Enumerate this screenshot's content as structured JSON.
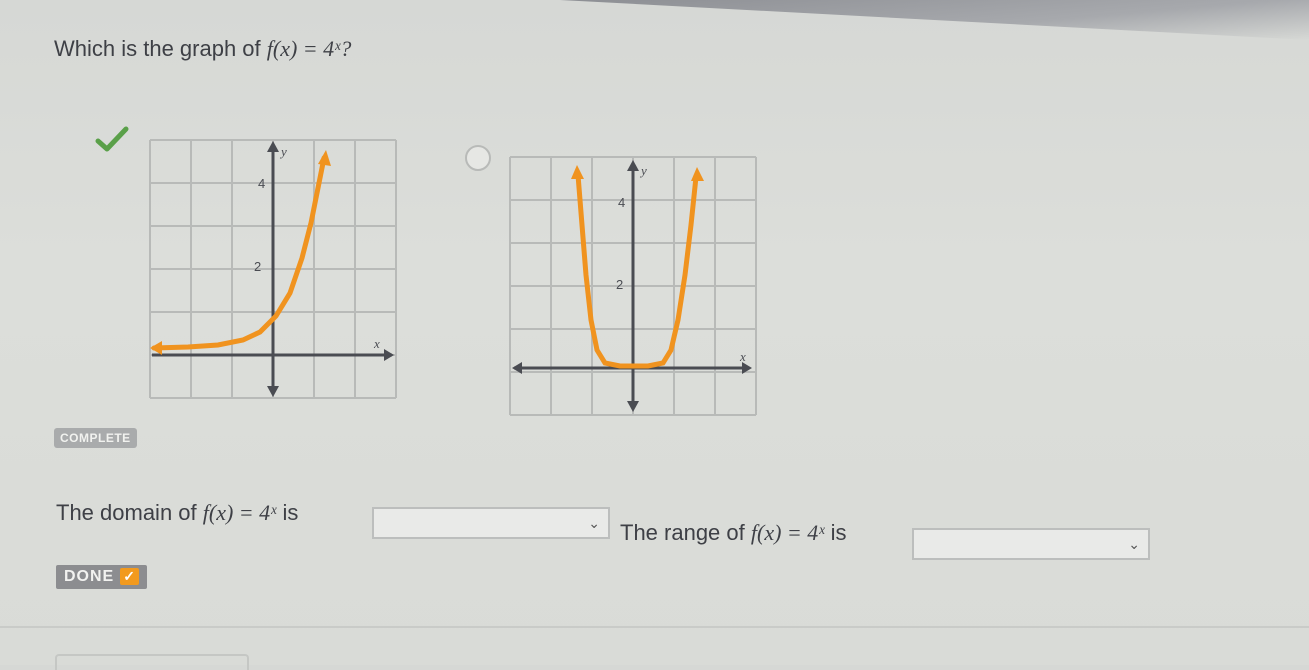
{
  "question": {
    "prefix": "Which is the graph of ",
    "function": "f(x) = 4ˣ?"
  },
  "graphs": [
    {
      "y_tick_upper": "4",
      "y_tick_lower": "2",
      "x_axis_label": "x",
      "y_axis_label": "y",
      "selected": true
    },
    {
      "y_tick_upper": "4",
      "y_tick_lower": "2",
      "x_axis_label": "x",
      "y_axis_label": "y",
      "selected": false
    }
  ],
  "status_badge": "COMPLETE",
  "domain_sentence": {
    "prefix": "The domain of ",
    "function": "f(x) = 4ˣ",
    "suffix": " is"
  },
  "range_sentence": {
    "prefix": "The range of ",
    "function": "f(x) = 4ˣ",
    "suffix": " is"
  },
  "dropdown_chevron": "⌄",
  "done_label": "DONE",
  "done_check": "✓",
  "colors": {
    "curve": "#f0931f",
    "grid": "#b8bab8",
    "axis": "#4a4c52",
    "check": "#5aa049"
  }
}
